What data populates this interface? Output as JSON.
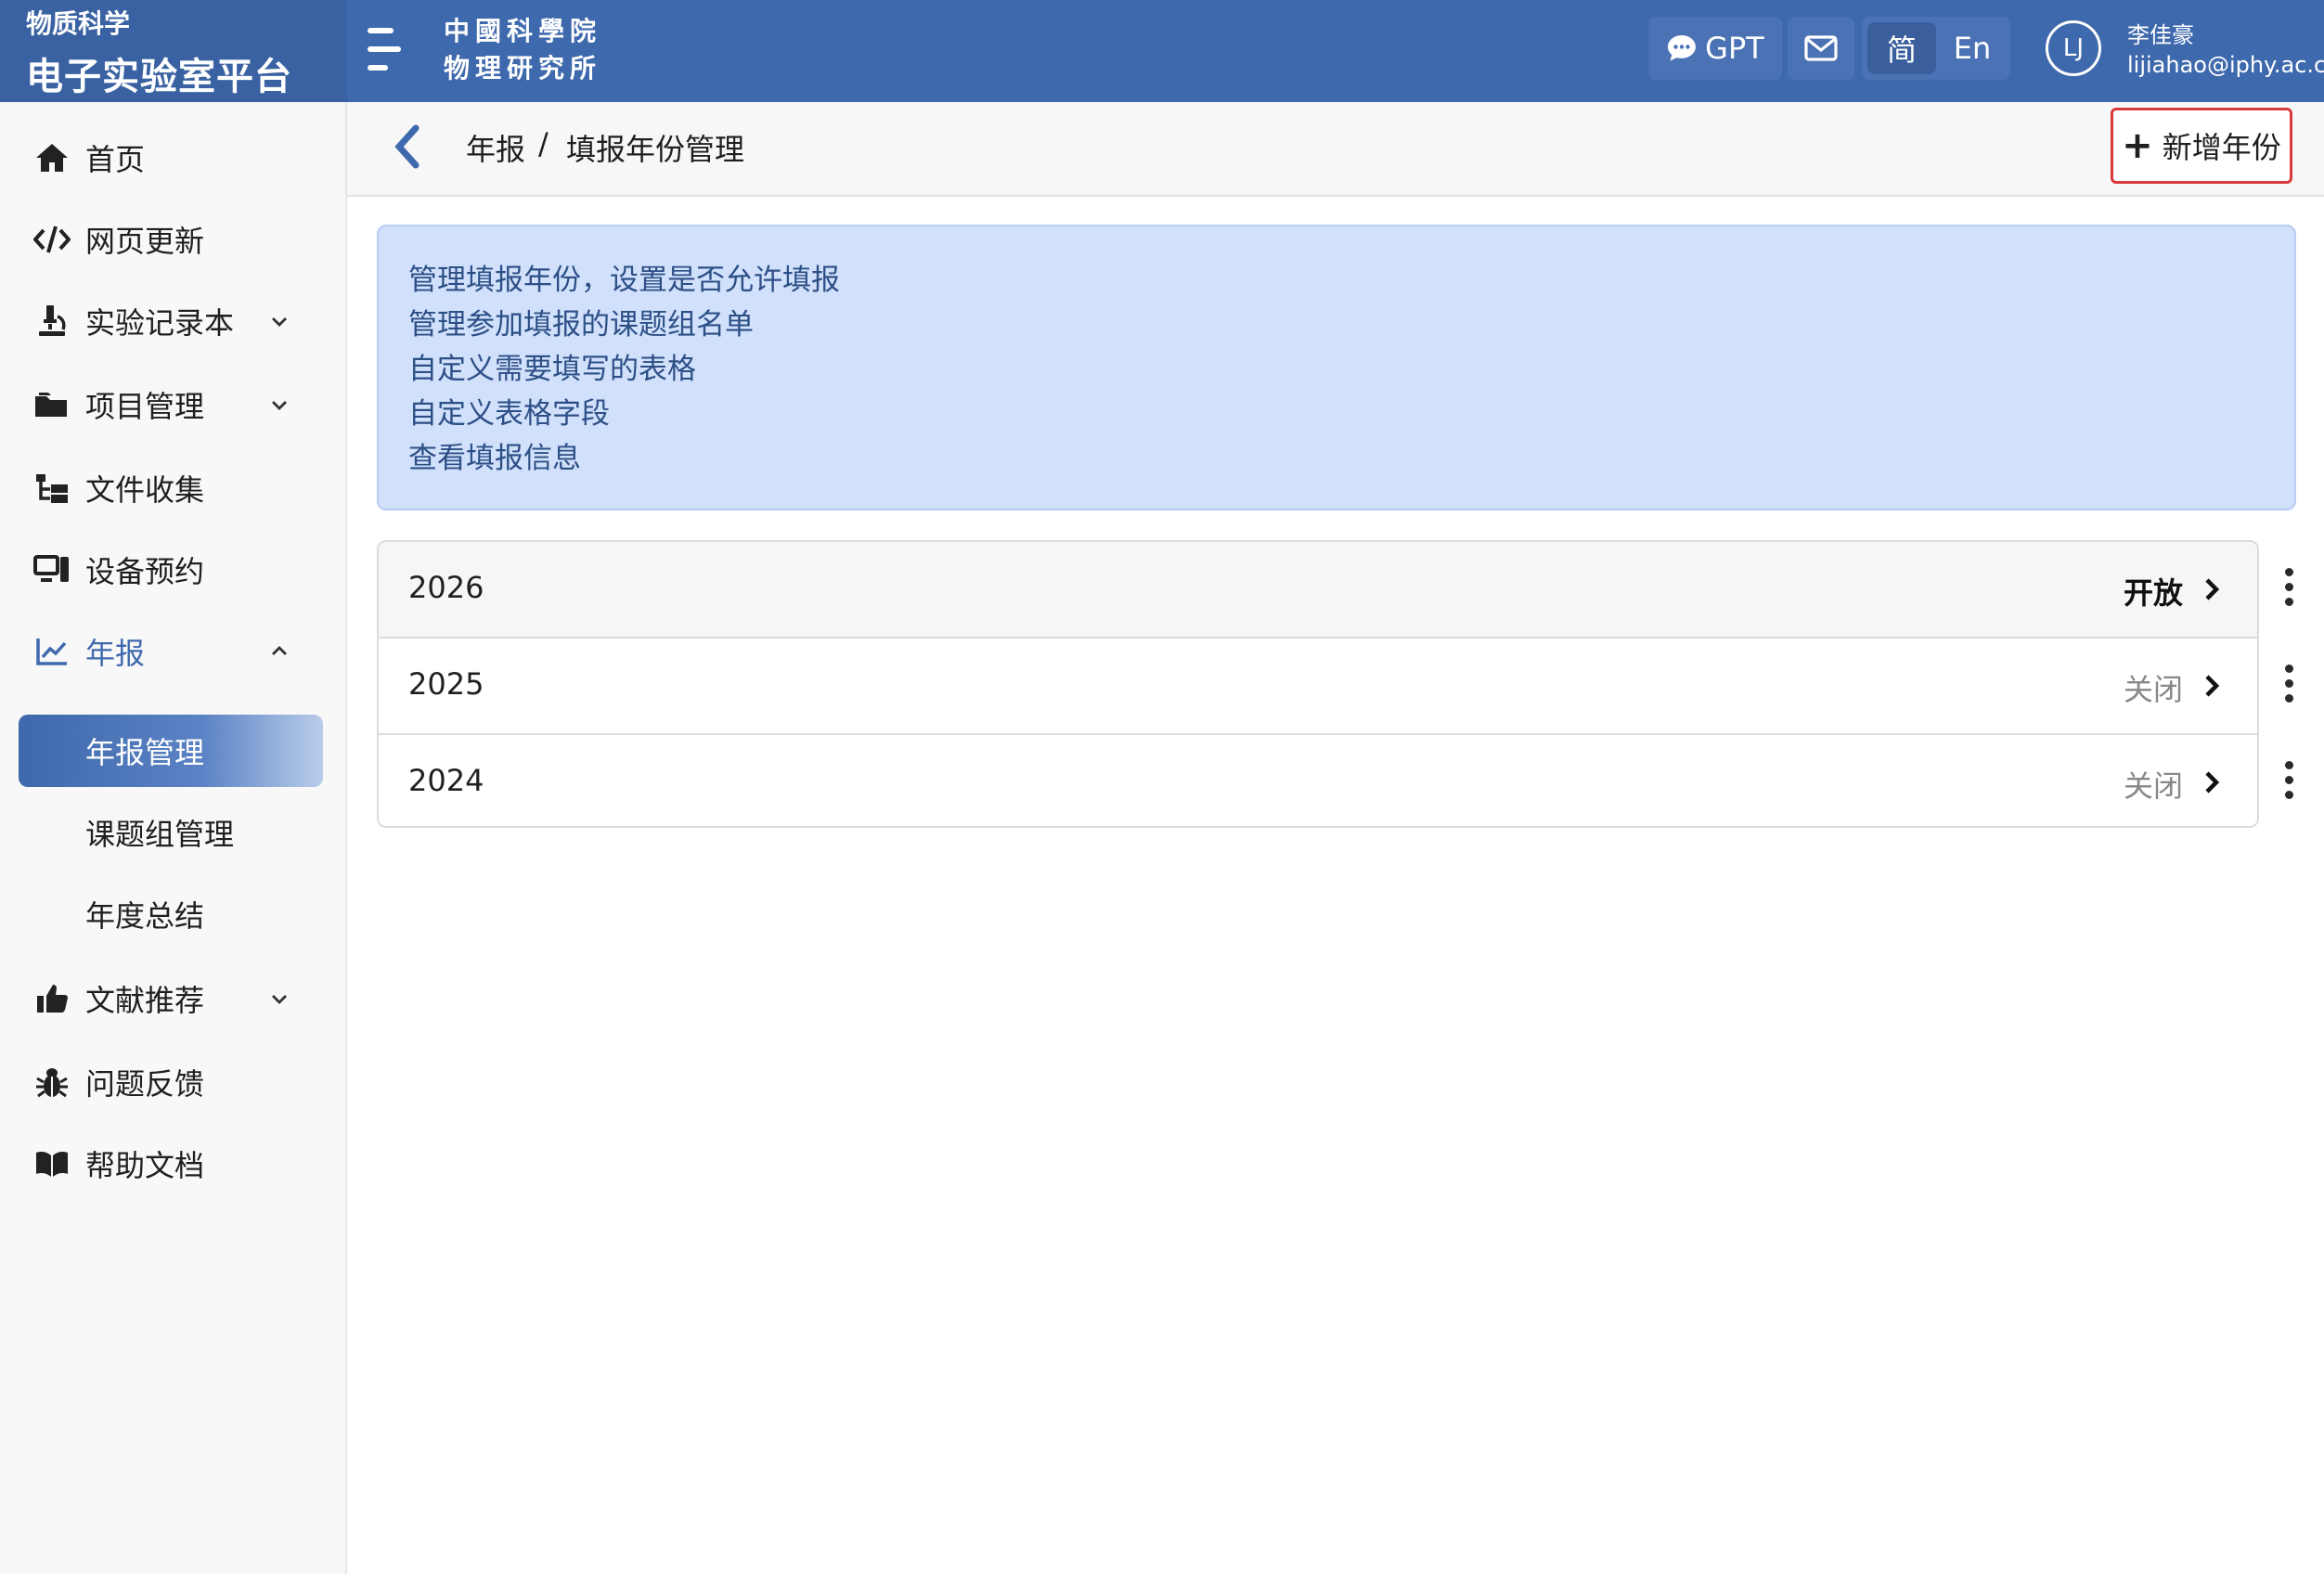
{
  "header": {
    "brand_sub": "物质科学",
    "brand_main": "电子实验室平台",
    "logo_line1": "中國科學院",
    "logo_line2": "物理研究所",
    "gpt_label": "GPT",
    "lang_zh": "简",
    "lang_en": "En",
    "avatar_initials": "LJ",
    "user_name": "李佳豪",
    "user_email": "lijiahao@iphy.ac.cn",
    "accent_color": "#3f69ad"
  },
  "sidebar": {
    "items": [
      {
        "label": "首页",
        "icon": "home-icon"
      },
      {
        "label": "网页更新",
        "icon": "code-icon"
      },
      {
        "label": "实验记录本",
        "icon": "microscope-icon"
      },
      {
        "label": "项目管理",
        "icon": "folder-icon"
      },
      {
        "label": "文件收集",
        "icon": "tree-icon"
      },
      {
        "label": "设备预约",
        "icon": "computer-icon"
      },
      {
        "label": "年报",
        "icon": "chart-line-icon"
      },
      {
        "label": "文献推荐",
        "icon": "thumbs-up-icon"
      },
      {
        "label": "问题反馈",
        "icon": "bug-icon"
      },
      {
        "label": "帮助文档",
        "icon": "book-icon"
      }
    ],
    "sub_items": [
      {
        "label": "年报管理"
      },
      {
        "label": "课题组管理"
      },
      {
        "label": "年度总结"
      }
    ]
  },
  "breadcrumb": {
    "root": "年报",
    "sep": "/",
    "current": "填报年份管理"
  },
  "toolbar": {
    "add_year_label": "新增年份"
  },
  "info": {
    "lines": [
      "管理填报年份，设置是否允许填报",
      "管理参加填报的课题组名单",
      "自定义需要填写的表格",
      "自定义表格字段",
      "查看填报信息"
    ]
  },
  "years": [
    {
      "year": "2026",
      "status": "开放"
    },
    {
      "year": "2025",
      "status": "关闭"
    },
    {
      "year": "2024",
      "status": "关闭"
    }
  ]
}
